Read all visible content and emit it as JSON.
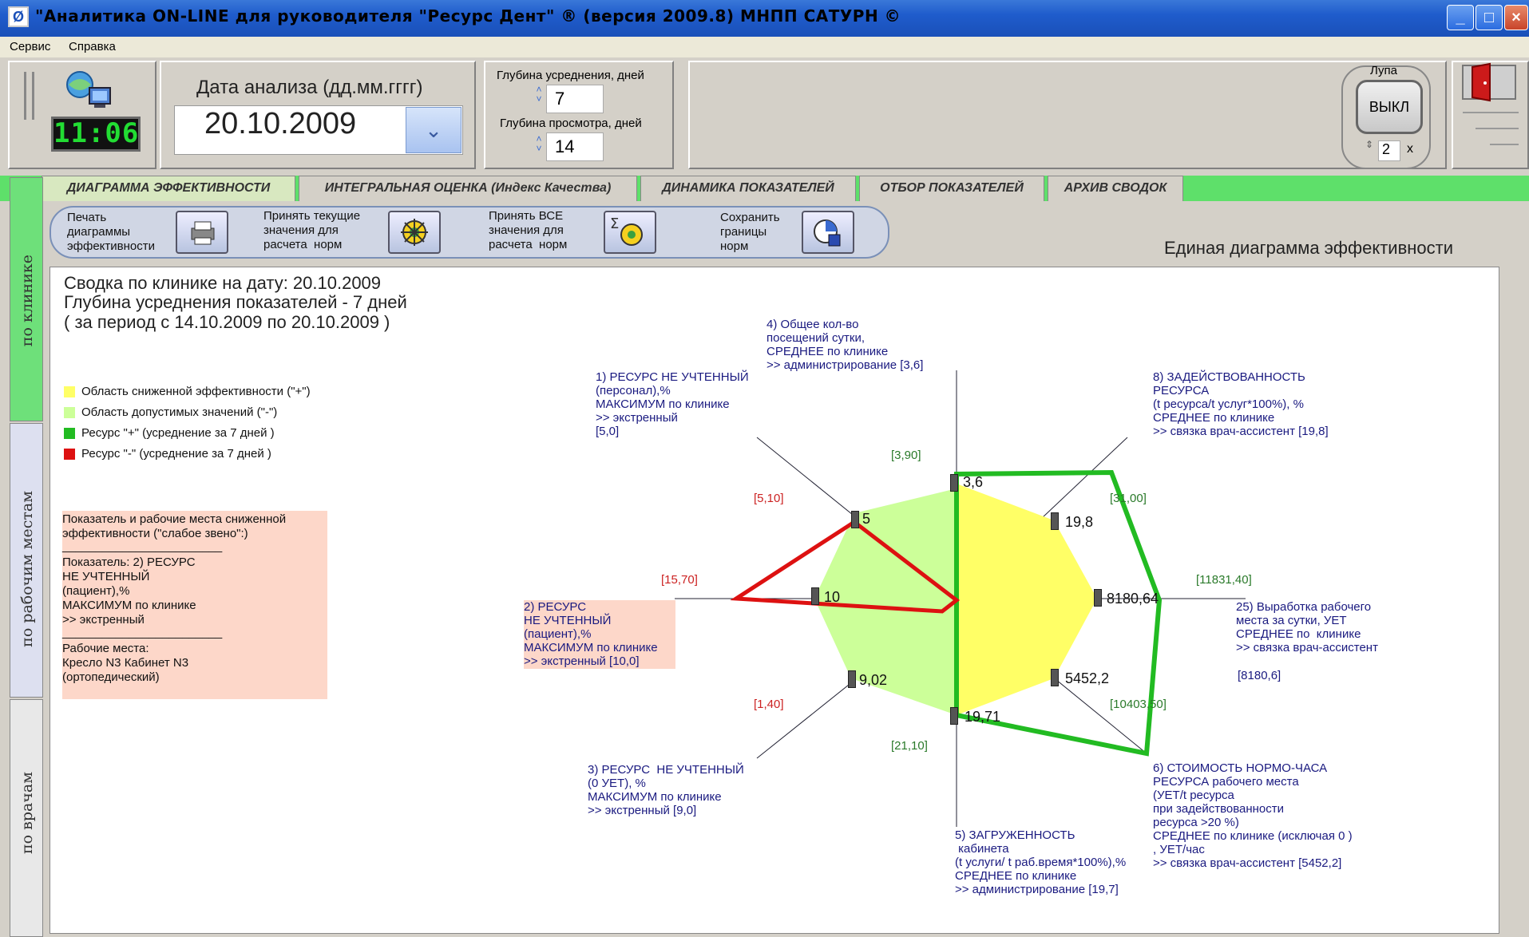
{
  "window": {
    "title": "\"Аналитика  ON-LINE для руководителя \"Ресурс Дент\" ® (версия  2009.8)   МНПП САТУРН ©",
    "app_icon": "app-icon",
    "buttons": [
      "minimize",
      "maximize",
      "close"
    ]
  },
  "menu": {
    "items": [
      "Сервис",
      "Справка"
    ]
  },
  "header": {
    "clock": "11:06",
    "date_label": "Дата анализа (дд.мм.гггг)",
    "date_value": "20.10.2009",
    "avg_depth_label": "Глубина усреднения, дней",
    "avg_depth_value": "7",
    "view_depth_label": "Глубина просмотра, дней",
    "view_depth_value": "14",
    "lupa_label": "Лупа",
    "lupa_button": "ВЫКЛ",
    "lupa_zoom": "2",
    "lupa_x": "x"
  },
  "tabs": [
    {
      "label": "ДИАГРАММА ЭФФЕКТИВНОСТИ",
      "active": true
    },
    {
      "label": "ИНТЕГРАЛЬНАЯ ОЦЕНКА  (Индекс Качества)",
      "active": false
    },
    {
      "label": "ДИНАМИКА ПОКАЗАТЕЛЕЙ",
      "active": false
    },
    {
      "label": "ОТБОР ПОКАЗАТЕЛЕЙ",
      "active": false
    },
    {
      "label": "АРХИВ СВОДОК",
      "active": false
    }
  ],
  "side_tabs": [
    "по клинике",
    "по рабочим местам",
    "по врачам"
  ],
  "actions": [
    {
      "label": "Печать\nдиаграммы\nэффективности"
    },
    {
      "label": "Принять текущие\nзначения для\nрасчета  норм"
    },
    {
      "label": "Принять ВСЕ\nзначения для\nрасчета  норм"
    },
    {
      "label": "Сохранить\nграницы\nнорм"
    }
  ],
  "diagram_title": "Единая диаграмма эффективности",
  "summary": {
    "line1": "Сводка по клинике на дату:  20.10.2009",
    "line2": " Глубина усреднения  показателей - 7 дней",
    "line3": " ( за период с 14.10.2009 по 20.10.2009  )"
  },
  "legend": [
    {
      "text": "Область сниженной эффективности (\"+\")",
      "color": "#ffff66"
    },
    {
      "text": "Область допустимых значений  (\"-\")",
      "color": "#ccff99"
    },
    {
      "text": "Ресурс \"+\"  (усреднение за 7 дней )",
      "color": "#22bb22"
    },
    {
      "text": "Ресурс \"-\"  (усреднение за 7 дней )",
      "color": "#dd1111"
    }
  ],
  "weak_link": {
    "title1": "Показатель и рабочие места сниженной",
    "title2": "эффективности (\"слабое звено\":)",
    "sep1": "________________________",
    "ind1": "Показатель: 2) РЕСУРС",
    "ind2": "НЕ УЧТЕННЫЙ",
    "ind3": "(пациент),%",
    "ind4": "МАКСИМУМ по клинике",
    "ind5": ">> экстренный",
    "sep2": "________________________",
    "wp1": "Рабочие места:",
    "wp2": "Кресло N3  Кабинет N3",
    "wp3": "(ортопедический)"
  },
  "chart_data": {
    "type": "radar",
    "axes": [
      {
        "label": "1) РЕСУРС НЕ УЧТЕННЫЙ\n(персонал),%\nМАКСИМУМ по клинике\n>> экстренный\n[5,0]",
        "value": "5",
        "range": "[5,10]"
      },
      {
        "label": "2) РЕСУРС\nНЕ УЧТЕННЫЙ\n(пациент),%\nМАКСИМУМ по клинике\n>> экстренный [10,0]",
        "value": "10",
        "range": "[15,70]"
      },
      {
        "label": "3) РЕСУРС  НЕ УЧТЕННЫЙ\n(0 УЕТ), %\nМАКСИМУМ по клинике\n>> экстренный [9,0]",
        "value": "9,02",
        "range": "[1,40]"
      },
      {
        "label": "4) Общее кол-во\nпосещений сутки,\nСРЕДНЕЕ по клинике\n>> администрирование [3,6]",
        "value": "3,6",
        "range": "[3,90]"
      },
      {
        "label": "5) ЗАГРУЖЕННОСТЬ\n кабинета\n(t услуги/ t раб.время*100%),%\nСРЕДНЕЕ по клинике\n>> администрирование [19,7]",
        "value": "19,71",
        "range": "[21,10]"
      },
      {
        "label": "6) СТОИМОСТЬ НОРМО-ЧАСА\nРЕСУРСА рабочего места\n(УЕТ/t ресурса\nпри задействованности\nресурса >20 %)\nСРЕДНЕЕ по клинике (исключая 0 )\n, УЕТ/час\n>> связка врач-ассистент [5452,2]",
        "value": "5452,2",
        "range": "[10403,50]"
      },
      {
        "label": "8) ЗАДЕЙСТВОВАННОСТЬ\nРЕСУРСА\n(t ресурса/t услуг*100%), %\nСРЕДНЕЕ по клинике\n>> связка врач-ассистент [19,8]",
        "value": "19,8",
        "range": "[31,00]"
      },
      {
        "label": "25) Выработка рабочего\nместа за сутки, УЕТ\nСРЕДНЕЕ по  клинике\n>> связка врач-ассистент",
        "value": "8180,64",
        "range": "[11831,40]",
        "extra": "[8180,6]"
      }
    ],
    "colors": {
      "yellow": "#ffff66",
      "green_area": "#ccff99",
      "green_line": "#22bb22",
      "red_line": "#dd1111"
    }
  }
}
